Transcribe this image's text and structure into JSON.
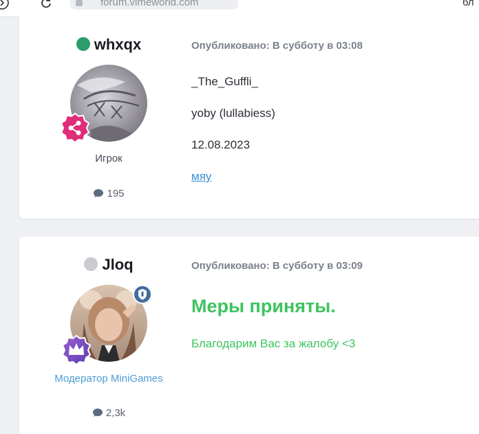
{
  "browser": {
    "url_text": "forum.vimeworld.com",
    "right_text": "бл"
  },
  "posts": [
    {
      "author": {
        "name": "whxqx",
        "online": true,
        "role": "Игрок",
        "role_color": "#444a55",
        "post_count": "195"
      },
      "date": "Опубликовано: В субботу в 03:08",
      "lines": [
        "_The_Guffli_",
        "yoby (lullabiess)",
        "12.08.2023"
      ],
      "link": "мяу"
    },
    {
      "author": {
        "name": "Jloq",
        "online": false,
        "role": "Модератор MiniGames",
        "role_color": "#4d9bd4",
        "post_count": "2,3k"
      },
      "date": "Опубликовано: В субботу в 03:09",
      "heading": "Меры приняты.",
      "message": "Благодарим Вас за жалобу <3"
    }
  ],
  "colors": {
    "online": "#2a9d6a",
    "offline": "#c9cbd0",
    "accent_green": "#3ec35f",
    "link": "#3d8fd6"
  }
}
